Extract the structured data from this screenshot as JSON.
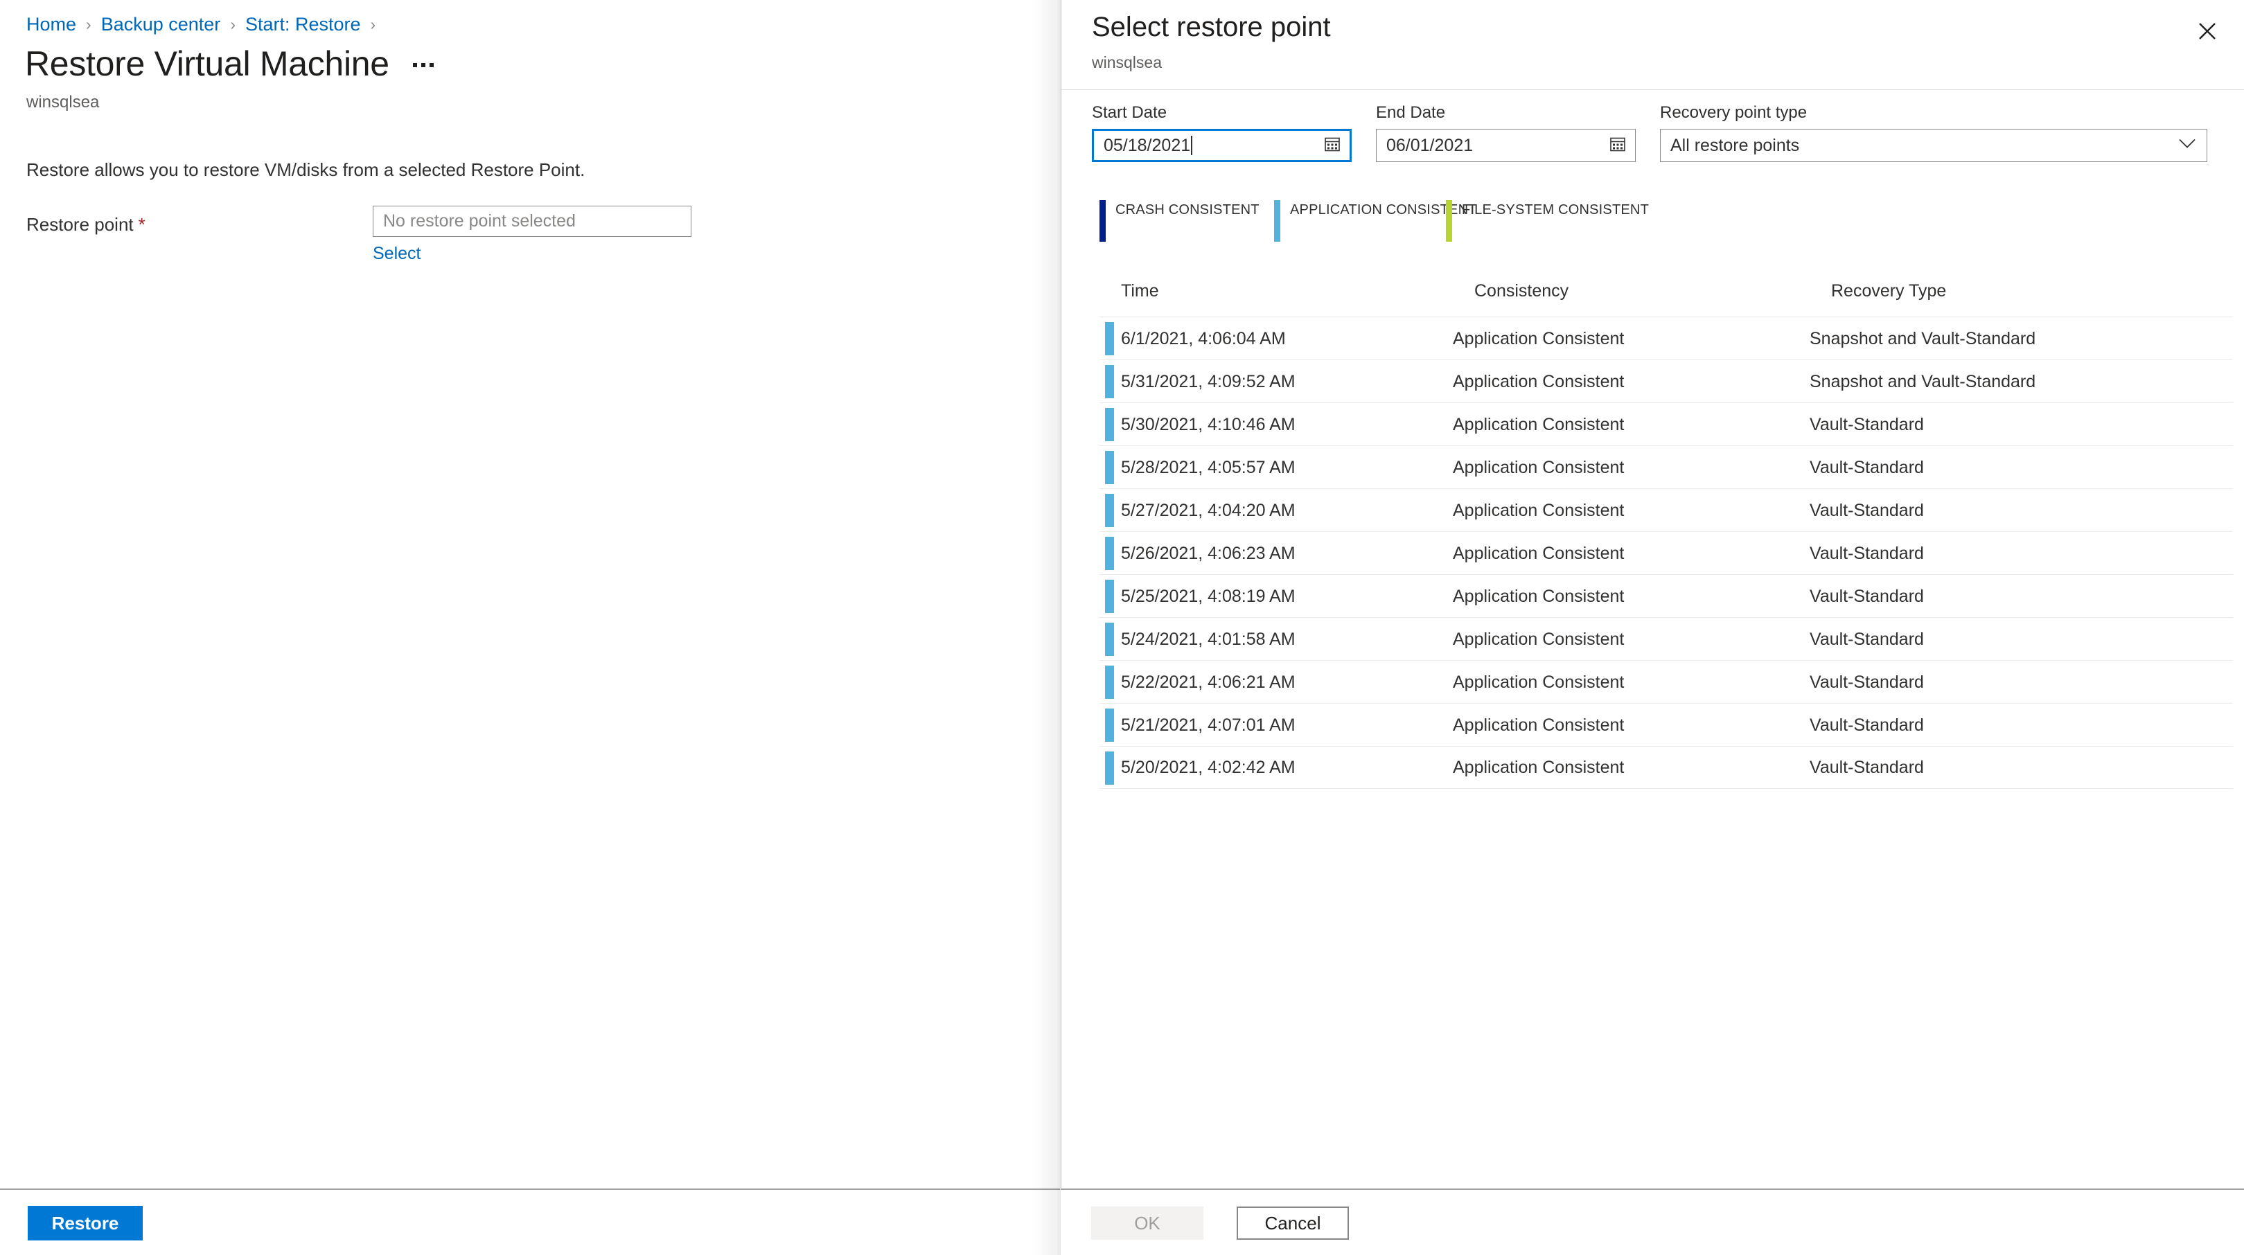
{
  "left_blade": {
    "breadcrumb": [
      {
        "label": "Home"
      },
      {
        "label": "Backup center"
      },
      {
        "label": "Start: Restore"
      }
    ],
    "breadcrumb_separator": "›",
    "title": "Restore Virtual Machine",
    "subtitle": "winsqlsea",
    "more_menu_name": "ellipsis-menu",
    "intro": "Restore allows you to restore VM/disks from a selected Restore Point.",
    "restore_point_label": "Restore point",
    "required_marker": "*",
    "restore_point_value": "No restore point selected",
    "select_link": "Select",
    "footer_button": "Restore"
  },
  "pane": {
    "title": "Select restore point",
    "subtitle": "winsqlsea",
    "close_icon": "close-icon",
    "filters": {
      "start_date": {
        "label": "Start Date",
        "value": "05/18/2021",
        "icon": "calendar-icon",
        "focused": true
      },
      "end_date": {
        "label": "End Date",
        "value": "06/01/2021",
        "icon": "calendar-icon",
        "focused": false
      },
      "recovery_point_type": {
        "label": "Recovery point type",
        "value": "All restore points",
        "icon": "chevron-down-icon",
        "options": [
          "All restore points"
        ]
      }
    },
    "legend": [
      {
        "label": "CRASH CONSISTENT",
        "color": "#00208c"
      },
      {
        "label": "APPLICATION CONSISTENT",
        "color": "#53b1dd"
      },
      {
        "label": "FILE-SYSTEM CONSISTENT",
        "color": "#b8d432"
      }
    ],
    "table": {
      "columns": [
        "Time",
        "Consistency",
        "Recovery Type"
      ],
      "rows": [
        {
          "indicator_color": "#53b1dd",
          "time": "6/1/2021, 4:06:04 AM",
          "consistency": "Application Consistent",
          "recovery_type": "Snapshot and Vault-Standard"
        },
        {
          "indicator_color": "#53b1dd",
          "time": "5/31/2021, 4:09:52 AM",
          "consistency": "Application Consistent",
          "recovery_type": "Snapshot and Vault-Standard"
        },
        {
          "indicator_color": "#53b1dd",
          "time": "5/30/2021, 4:10:46 AM",
          "consistency": "Application Consistent",
          "recovery_type": "Vault-Standard"
        },
        {
          "indicator_color": "#53b1dd",
          "time": "5/28/2021, 4:05:57 AM",
          "consistency": "Application Consistent",
          "recovery_type": "Vault-Standard"
        },
        {
          "indicator_color": "#53b1dd",
          "time": "5/27/2021, 4:04:20 AM",
          "consistency": "Application Consistent",
          "recovery_type": "Vault-Standard"
        },
        {
          "indicator_color": "#53b1dd",
          "time": "5/26/2021, 4:06:23 AM",
          "consistency": "Application Consistent",
          "recovery_type": "Vault-Standard"
        },
        {
          "indicator_color": "#53b1dd",
          "time": "5/25/2021, 4:08:19 AM",
          "consistency": "Application Consistent",
          "recovery_type": "Vault-Standard"
        },
        {
          "indicator_color": "#53b1dd",
          "time": "5/24/2021, 4:01:58 AM",
          "consistency": "Application Consistent",
          "recovery_type": "Vault-Standard"
        },
        {
          "indicator_color": "#53b1dd",
          "time": "5/22/2021, 4:06:21 AM",
          "consistency": "Application Consistent",
          "recovery_type": "Vault-Standard"
        },
        {
          "indicator_color": "#53b1dd",
          "time": "5/21/2021, 4:07:01 AM",
          "consistency": "Application Consistent",
          "recovery_type": "Vault-Standard"
        },
        {
          "indicator_color": "#53b1dd",
          "time": "5/20/2021, 4:02:42 AM",
          "consistency": "Application Consistent",
          "recovery_type": "Vault-Standard"
        }
      ]
    },
    "footer": {
      "ok_label": "OK",
      "ok_disabled": true,
      "cancel_label": "Cancel"
    }
  },
  "colors": {
    "accent_blue": "#0078d4",
    "link_blue": "#0067b8",
    "required_red": "#a4262c",
    "text_primary": "#323130",
    "text_secondary": "#605e5c"
  }
}
